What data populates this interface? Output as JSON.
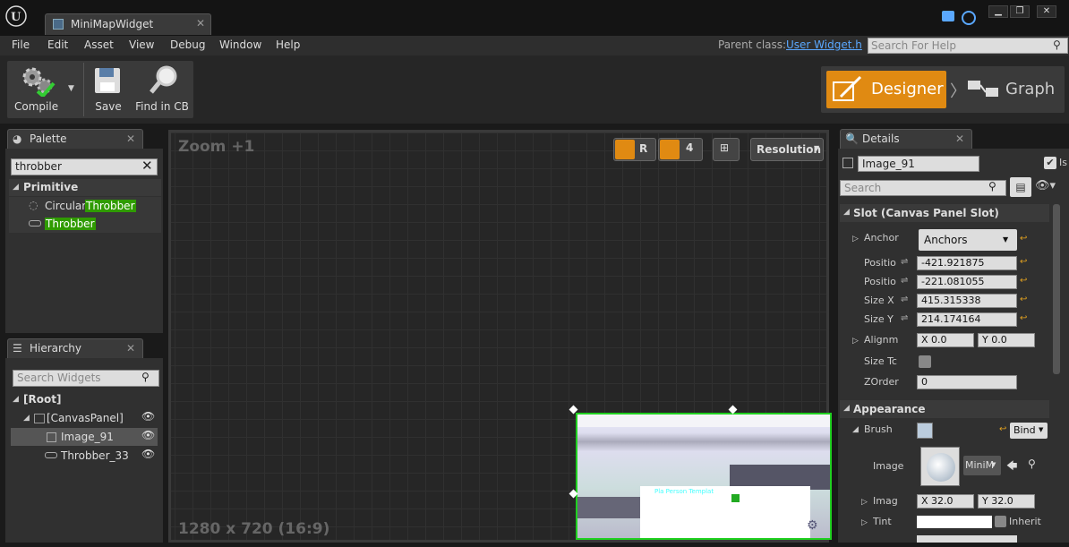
{
  "window": {
    "tab_title": "MiniMapWidget"
  },
  "menu": {
    "items": [
      "File",
      "Edit",
      "Asset",
      "View",
      "Debug",
      "Window",
      "Help"
    ],
    "parent_class_label": "Parent class:",
    "parent_class_value": "User Widget.h",
    "help_search_placeholder": "Search For Help"
  },
  "toolbar": {
    "compile": "Compile",
    "save": "Save",
    "find": "Find in CB"
  },
  "modes": {
    "designer": "Designer",
    "graph": "Graph"
  },
  "palette": {
    "title": "Palette",
    "search_value": "throbber",
    "category": "Primitive",
    "items": [
      {
        "prefix": "Circular ",
        "match": "Throbber"
      },
      {
        "prefix": "",
        "match": "Throbber"
      }
    ]
  },
  "hierarchy": {
    "title": "Hierarchy",
    "search_placeholder": "Search Widgets",
    "root": "[Root]",
    "canvas": "[CanvasPanel]",
    "image": "Image_91",
    "throbber": "Throbber_33"
  },
  "viewport": {
    "zoom": "Zoom +1",
    "resolution_text": "1280 x 720 (16:9)",
    "r_label": "R",
    "grid_value": "4",
    "resolution_button": "Resolution",
    "overlay_text": "Pla Person Templat"
  },
  "details": {
    "title": "Details",
    "name_value": "Image_91",
    "is_label": "Is",
    "search_placeholder": "Search",
    "slot_section": "Slot (Canvas Panel Slot)",
    "anchor_label": "Anchor",
    "anchor_value": "Anchors",
    "pos_x_label": "Positio",
    "pos_x": "-421.921875",
    "pos_y_label": "Positio",
    "pos_y": "-221.081055",
    "size_x_label": "Size X",
    "size_x": "415.315338",
    "size_y_label": "Size Y",
    "size_y": "214.174164",
    "align_label": "Alignme",
    "align_x": "X  0.0",
    "align_y": "Y  0.0",
    "size_to_label": "Size Tc",
    "zorder_label": "ZOrder",
    "zorder": "0",
    "appearance_section": "Appearance",
    "brush_label": "Brush",
    "bind_label": "Bind",
    "image_label": "Image",
    "image_value": "MiniM",
    "imagesize_label": "Imag",
    "imgsize_x": "X  32.0",
    "imgsize_y": "Y  32.0",
    "tint_label": "Tint",
    "inherit_label": "Inherit"
  },
  "colors": {
    "accent": "#e08a12",
    "highlight": "#2f9b00",
    "selection": "#20d020",
    "link": "#5aa8ff"
  }
}
